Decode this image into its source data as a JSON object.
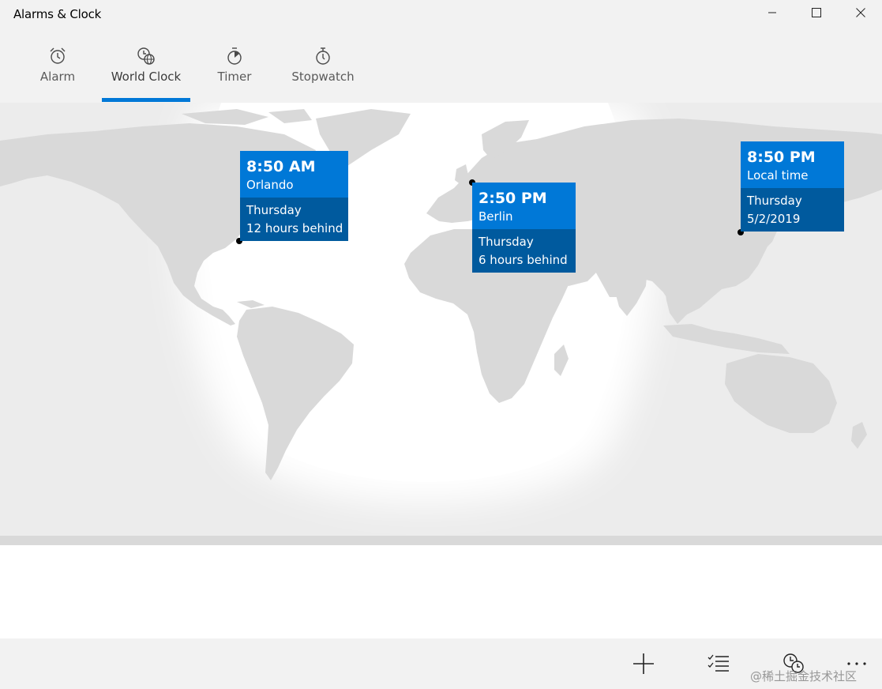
{
  "app": {
    "title": "Alarms & Clock"
  },
  "window_controls": {
    "minimize_icon": "minimize-icon",
    "maximize_icon": "maximize-icon",
    "close_icon": "close-icon"
  },
  "tabs": [
    {
      "label": "Alarm",
      "icon": "alarm-clock-icon",
      "active": false
    },
    {
      "label": "World Clock",
      "icon": "world-clock-icon",
      "active": true
    },
    {
      "label": "Timer",
      "icon": "timer-icon",
      "active": false
    },
    {
      "label": "Stopwatch",
      "icon": "stopwatch-icon",
      "active": false
    }
  ],
  "cities": [
    {
      "time": "8:50 AM",
      "name": "Orlando",
      "day": "Thursday",
      "offset": "12 hours behind"
    },
    {
      "time": "2:50 PM",
      "name": "Berlin",
      "day": "Thursday",
      "offset": "6 hours behind"
    },
    {
      "time": "8:50 PM",
      "name": "Local time",
      "day": "Thursday",
      "offset": "5/2/2019"
    }
  ],
  "commandbar": {
    "add_icon": "add-icon",
    "select_icon": "select-list-icon",
    "compare_icon": "compare-clock-icon",
    "more_icon": "more-icon"
  },
  "watermark": "@稀土掘金技术社区",
  "colors": {
    "accent": "#0078d7",
    "accent_dark": "#005a9e",
    "chrome": "#f2f2f2",
    "land": "#d9d9d9",
    "night": "#ececec"
  }
}
